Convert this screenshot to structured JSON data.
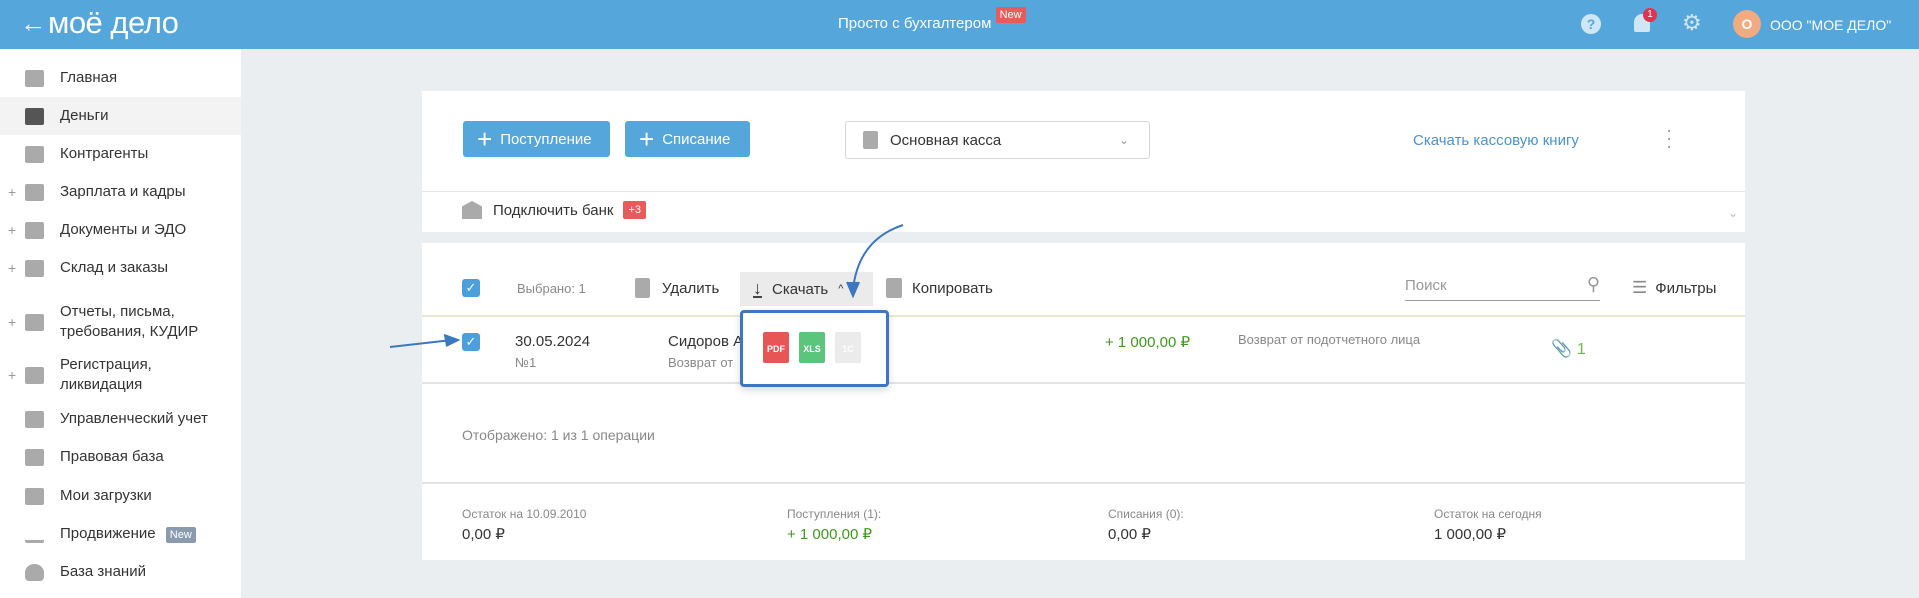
{
  "header": {
    "logo": "моё дело",
    "title": "Просто с бухгалтером",
    "title_badge": "New",
    "notifications": "1",
    "avatar_letter": "О",
    "company": "ООО \"МОЕ ДЕЛО\""
  },
  "sidebar": {
    "items": [
      {
        "label": "Главная"
      },
      {
        "label": "Деньги"
      },
      {
        "label": "Контрагенты"
      },
      {
        "label": "Зарплата и кадры"
      },
      {
        "label": "Документы и ЭДО"
      },
      {
        "label": "Склад и заказы"
      },
      {
        "label": "Отчеты, письма, требования, КУДИР"
      },
      {
        "label": "Регистрация, ликвидация"
      },
      {
        "label": "Управленческий учет"
      },
      {
        "label": "Правовая база"
      },
      {
        "label": "Мои загрузки"
      },
      {
        "label": "Продвижение",
        "badge": "New"
      },
      {
        "label": "База знаний"
      }
    ]
  },
  "toolbar": {
    "income": "Поступление",
    "expense": "Списание",
    "cashbox": "Основная касса",
    "download_book": "Скачать кассовую книгу"
  },
  "bank": {
    "label": "Подключить банк",
    "badge": "+3"
  },
  "actions": {
    "selected": "Выбрано: 1",
    "delete": "Удалить",
    "download": "Скачать",
    "copy": "Копировать",
    "search_placeholder": "Поиск",
    "filters": "Фильтры"
  },
  "download_menu": [
    "PDF",
    "XLS",
    "1С"
  ],
  "rows": [
    {
      "date": "30.05.2024",
      "number": "№1",
      "name": "Сидоров А",
      "subtitle": "Возврат от",
      "amount": "+ 1 000,00 ₽",
      "description": "Возврат от подотчетного лица",
      "attachments": "1"
    }
  ],
  "shown": "Отображено: 1 из 1 операции",
  "summary": [
    {
      "label": "Остаток на 10.09.2010",
      "value": "0,00 ₽"
    },
    {
      "label": "Поступления (1):",
      "value": "+ 1 000,00 ₽"
    },
    {
      "label": "Списания (0):",
      "value": "0,00 ₽"
    },
    {
      "label": "Остаток на сегодня",
      "value": "1 000,00 ₽"
    }
  ]
}
